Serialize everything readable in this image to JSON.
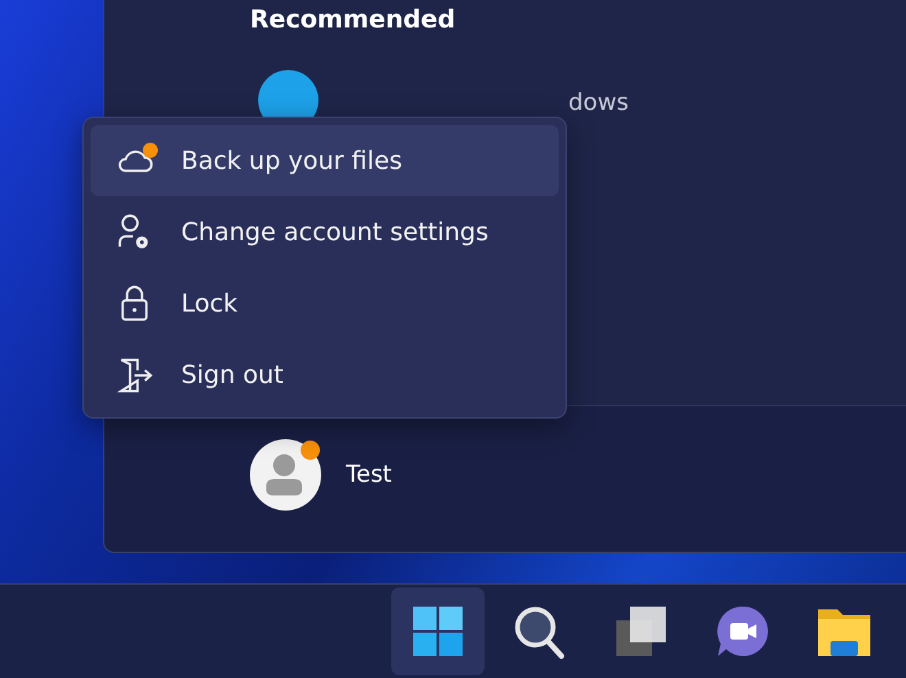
{
  "start_menu": {
    "section_title": "Recommended",
    "recommended_item": {
      "subtitle": "dows"
    },
    "user": {
      "name": "Test",
      "notification": true
    }
  },
  "account_menu": {
    "items": [
      {
        "kind": "backup",
        "label": "Back up your files",
        "selected": true,
        "notification": true
      },
      {
        "kind": "account",
        "label": "Change account settings",
        "selected": false
      },
      {
        "kind": "lock",
        "label": "Lock",
        "selected": false
      },
      {
        "kind": "signout",
        "label": "Sign out",
        "selected": false
      }
    ]
  },
  "taskbar": {
    "items": [
      {
        "kind": "start",
        "selected": true
      },
      {
        "kind": "search",
        "selected": false
      },
      {
        "kind": "taskview",
        "selected": false
      },
      {
        "kind": "chat",
        "selected": false
      },
      {
        "kind": "explorer",
        "selected": false
      }
    ]
  }
}
